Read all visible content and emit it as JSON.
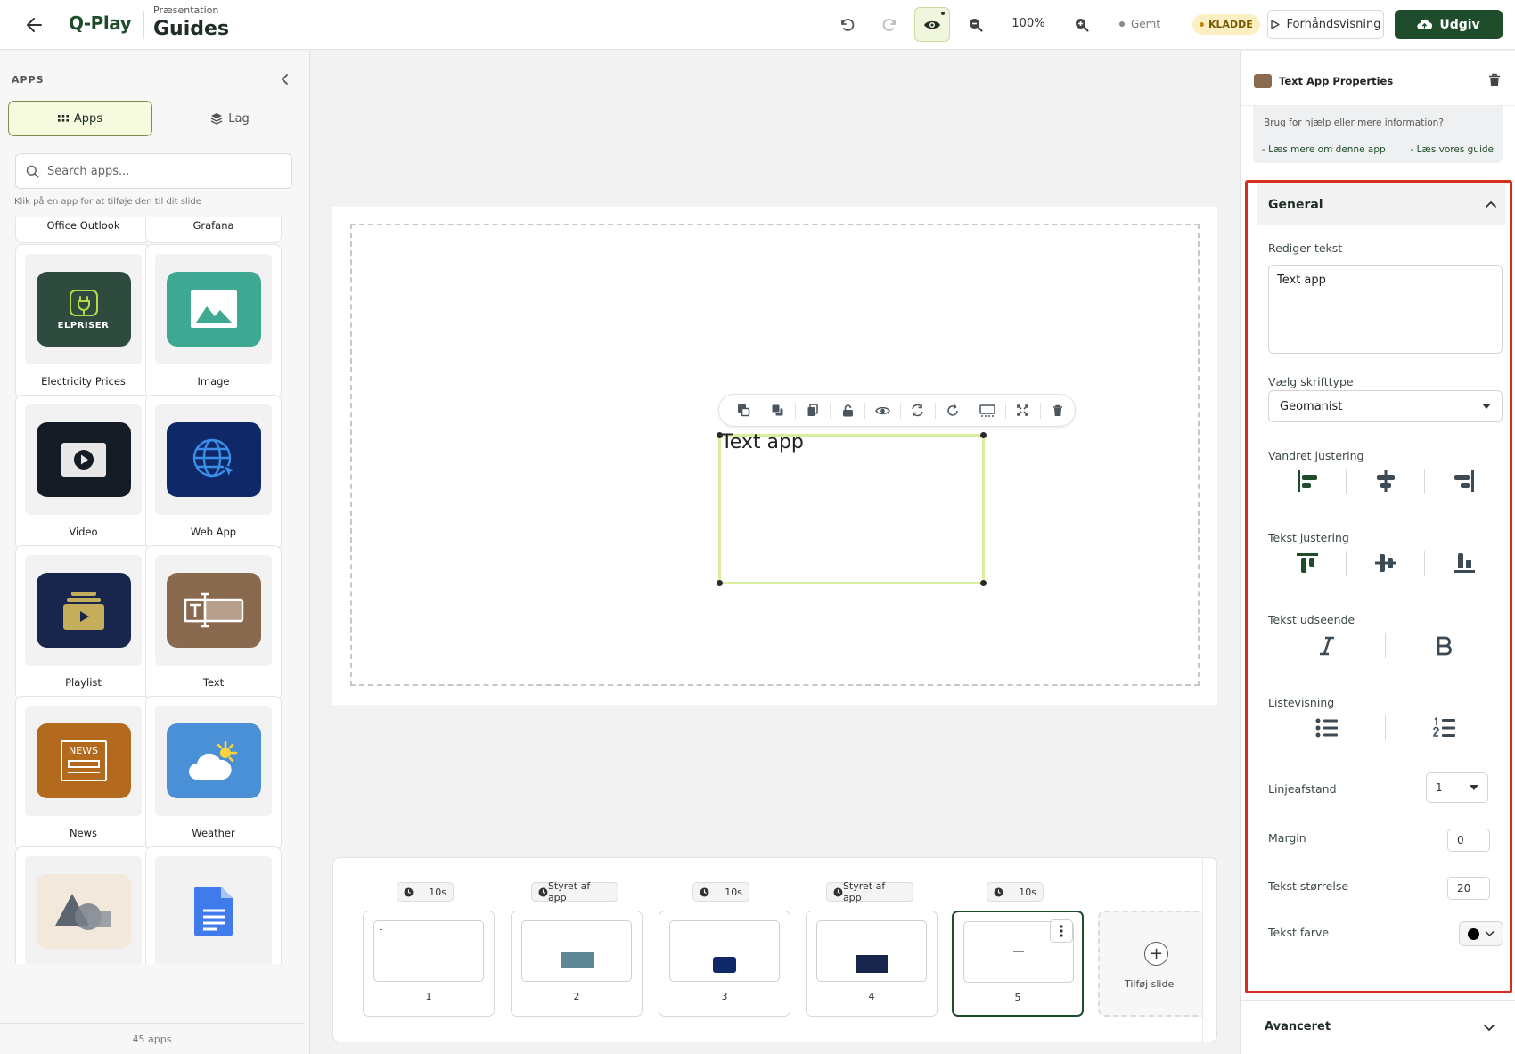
{
  "topbar": {
    "logo": "Q-Play",
    "breadcrumb": "Præsentation",
    "title": "Guides",
    "zoom": "100%",
    "saved_status": "Gemt",
    "draft_badge": "KLADDE",
    "preview_label": "Forhåndsvisning",
    "publish_label": "Udgiv"
  },
  "left_panel": {
    "title": "APPS",
    "tabs": [
      {
        "label": "Apps",
        "active": true
      },
      {
        "label": "Lag",
        "active": false
      }
    ],
    "search_placeholder": "Search apps...",
    "hint": "Klik på en app for at tilføje den til dit slide",
    "cut_labels": [
      "Office Outlook",
      "Grafana"
    ],
    "apps": [
      {
        "label": "Electricity Prices",
        "icon": "elpriser-icon",
        "icon_text": "ELPRISER",
        "color": "#2f4a3f"
      },
      {
        "label": "Image",
        "icon": "image-icon",
        "color": "#3ea892"
      },
      {
        "label": "Video",
        "icon": "video-icon",
        "color": "#151c26"
      },
      {
        "label": "Web App",
        "icon": "web-app-icon",
        "color": "#0e2868"
      },
      {
        "label": "Playlist",
        "icon": "playlist-icon",
        "color": "#18254d"
      },
      {
        "label": "Text",
        "icon": "text-app-icon",
        "color": "#8a6a4f"
      },
      {
        "label": "News",
        "icon": "news-icon",
        "icon_text": "NEWS",
        "color": "#b36a1f"
      },
      {
        "label": "Weather",
        "icon": "weather-icon",
        "color": "#4a90d6"
      },
      {
        "label": "",
        "icon": "shapes-icon",
        "color": "#f2e9dc"
      },
      {
        "label": "",
        "icon": "google-docs-icon",
        "color": "#f2f2f3"
      }
    ],
    "count": "45 apps"
  },
  "canvas": {
    "text_content": "Text app"
  },
  "slides": {
    "items": [
      {
        "number": "1",
        "duration": "10s",
        "active": false
      },
      {
        "number": "2",
        "duration": "Styret af app",
        "active": false
      },
      {
        "number": "3",
        "duration": "10s",
        "active": false
      },
      {
        "number": "4",
        "duration": "Styret af app",
        "active": false
      },
      {
        "number": "5",
        "duration": "10s",
        "active": true
      }
    ],
    "add_label": "Tilføj slide"
  },
  "right_panel": {
    "title": "Text App Properties",
    "help_question": "Brug for hjælp eller mere information?",
    "help_link1": "- Læs mere om denne app",
    "help_link2": "- Læs vores guide",
    "general": {
      "title": "General",
      "edit_text_label": "Rediger tekst",
      "edit_text_value": "Text app",
      "font_label": "Vælg skrifttype",
      "font_value": "Geomanist",
      "h_align_label": "Vandret justering",
      "v_align_label": "Tekst justering",
      "appearance_label": "Tekst udseende",
      "list_label": "Listevisning",
      "line_spacing_label": "Linjeafstand",
      "line_spacing_value": "1",
      "margin_label": "Margin",
      "margin_value": "0",
      "size_label": "Tekst størrelse",
      "size_value": "20",
      "color_label": "Tekst farve",
      "color_value": "#000000"
    },
    "advanced_title": "Avanceret"
  },
  "colors": {
    "brand_green": "#1f4d2b",
    "accent_lime": "#d9ee9f",
    "highlight_red": "#d62e18"
  }
}
